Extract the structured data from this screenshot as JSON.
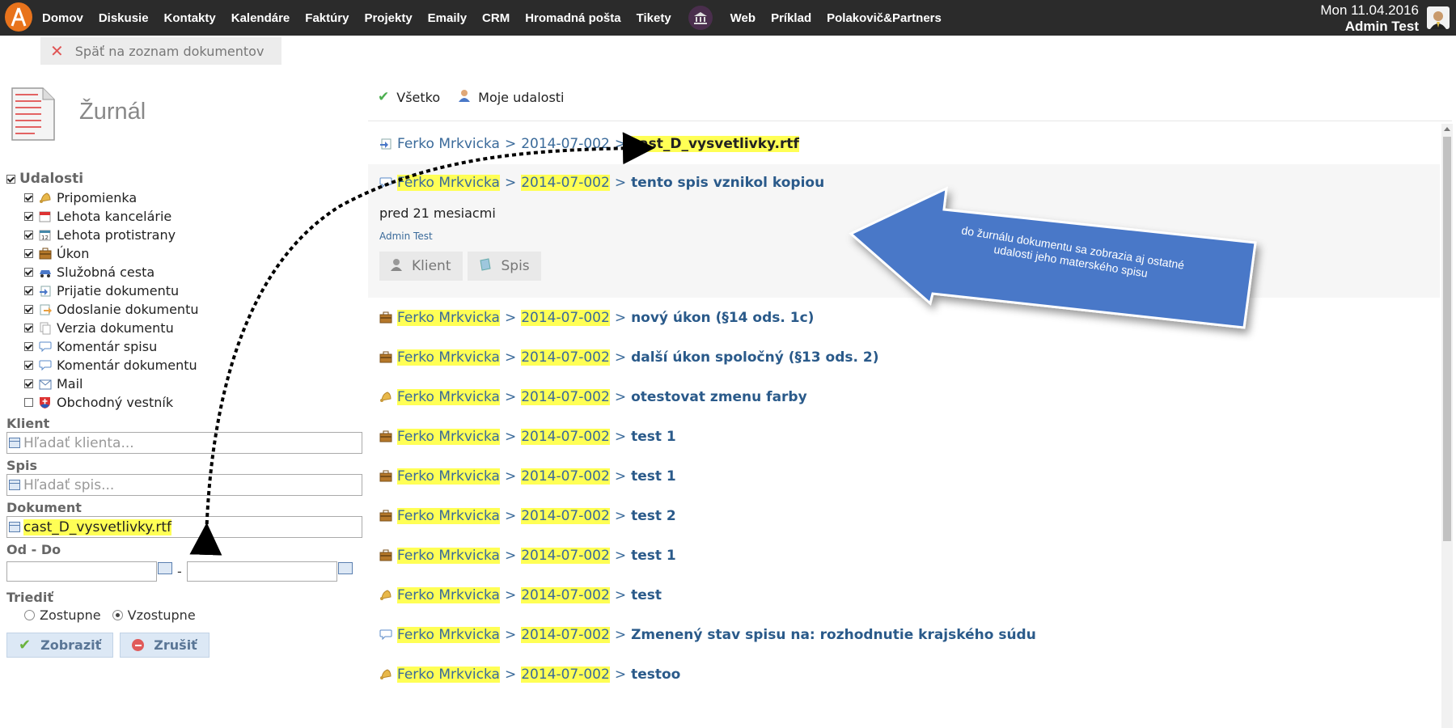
{
  "nav": {
    "items": [
      "Domov",
      "Diskusie",
      "Kontakty",
      "Kalendáre",
      "Faktúry",
      "Projekty",
      "Emaily",
      "CRM",
      "Hromadná pošta",
      "Tikety"
    ],
    "items2": [
      "Web",
      "Príklad",
      "Polakovič&Partners"
    ],
    "date": "Mon 11.04.2016",
    "user": "Admin Test"
  },
  "back_label": "Späť na zoznam dokumentov",
  "title": "Žurnál",
  "filters": {
    "group_label": "Udalosti",
    "events": [
      {
        "label": "Pripomienka",
        "checked": true,
        "icon": "bell-icon"
      },
      {
        "label": "Lehota kancelárie",
        "checked": true,
        "icon": "calendar-icon"
      },
      {
        "label": "Lehota protistrany",
        "checked": true,
        "icon": "calendar-12-icon"
      },
      {
        "label": "Úkon",
        "checked": true,
        "icon": "briefcase-icon"
      },
      {
        "label": "Služobná cesta",
        "checked": true,
        "icon": "car-icon"
      },
      {
        "label": "Prijatie dokumentu",
        "checked": true,
        "icon": "document-in-icon"
      },
      {
        "label": "Odoslanie dokumentu",
        "checked": true,
        "icon": "document-out-icon"
      },
      {
        "label": "Verzia dokumentu",
        "checked": true,
        "icon": "document-copy-icon"
      },
      {
        "label": "Komentár spisu",
        "checked": true,
        "icon": "comment-icon"
      },
      {
        "label": "Komentár dokumentu",
        "checked": true,
        "icon": "comment-icon"
      },
      {
        "label": "Mail",
        "checked": true,
        "icon": "mail-icon"
      },
      {
        "label": "Obchodný vestník",
        "checked": false,
        "icon": "shield-icon"
      }
    ],
    "client_label": "Klient",
    "client_placeholder": "Hľadať klienta...",
    "file_label": "Spis",
    "file_placeholder": "Hľadať spis...",
    "doc_label": "Dokument",
    "doc_value": "cast_D_vysvetlivky.rtf",
    "range_label": "Od - Do",
    "range_sep": "-",
    "sort_label": "Triediť",
    "sort_asc": "Zostupne",
    "sort_desc": "Vzostupne",
    "show_btn": "Zobraziť",
    "cancel_btn": "Zrušiť"
  },
  "tabs": {
    "all": "Všetko",
    "mine": "Moje udalosti"
  },
  "feed": {
    "first": {
      "person": "Ferko Mrkvicka",
      "case": "2014-07-002",
      "doc": "cast_D_vysvetlivky.rtf"
    },
    "expanded": {
      "person": "Ferko Mrkvicka",
      "case": "2014-07-002",
      "title": "tento spis vznikol kopiou",
      "ago": "pred 21 mesiacmi",
      "author": "Admin Test",
      "btn_client": "Klient",
      "btn_file": "Spis"
    },
    "rows": [
      {
        "icon": "briefcase-icon",
        "person": "Ferko Mrkvicka",
        "case": "2014-07-002",
        "title": "nový úkon (§14 ods. 1c)"
      },
      {
        "icon": "briefcase-icon",
        "person": "Ferko Mrkvicka",
        "case": "2014-07-002",
        "title": "další úkon spoločný (§13 ods. 2)"
      },
      {
        "icon": "bell-icon",
        "person": "Ferko Mrkvicka",
        "case": "2014-07-002",
        "title": "otestovat zmenu farby"
      },
      {
        "icon": "briefcase-icon",
        "person": "Ferko Mrkvicka",
        "case": "2014-07-002",
        "title": "test 1"
      },
      {
        "icon": "briefcase-icon",
        "person": "Ferko Mrkvicka",
        "case": "2014-07-002",
        "title": "test 1"
      },
      {
        "icon": "briefcase-icon",
        "person": "Ferko Mrkvicka",
        "case": "2014-07-002",
        "title": "test 2"
      },
      {
        "icon": "briefcase-icon",
        "person": "Ferko Mrkvicka",
        "case": "2014-07-002",
        "title": "test 1"
      },
      {
        "icon": "bell-icon",
        "person": "Ferko Mrkvicka",
        "case": "2014-07-002",
        "title": "test"
      },
      {
        "icon": "comment-icon",
        "person": "Ferko Mrkvicka",
        "case": "2014-07-002",
        "title": "Zmenený stav spisu na: rozhodnutie krajského súdu"
      },
      {
        "icon": "bell-icon",
        "person": "Ferko Mrkvicka",
        "case": "2014-07-002",
        "title": "testoo"
      }
    ]
  },
  "callout": "do žurnálu dokumentu sa zobrazia aj ostatné udalosti jeho materského spisu",
  "colors": {
    "highlight": "#ffff55",
    "link": "#3a6a9a",
    "callout": "#4a78c8"
  }
}
